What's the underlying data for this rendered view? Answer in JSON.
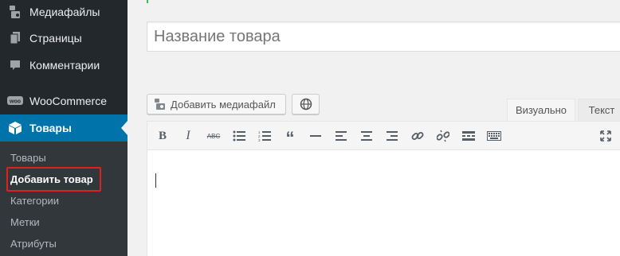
{
  "sidebar": {
    "menu": [
      {
        "label": "Медиафайлы",
        "icon": "media-icon"
      },
      {
        "label": "Страницы",
        "icon": "pages-icon"
      },
      {
        "label": "Комментарии",
        "icon": "comments-icon"
      },
      {
        "label": "WooCommerce",
        "icon": "woocommerce-icon"
      },
      {
        "label": "Товары",
        "icon": "products-icon",
        "active": true
      }
    ],
    "submenu": [
      {
        "label": "Товары"
      },
      {
        "label": "Добавить товар",
        "current": true
      },
      {
        "label": "Категории"
      },
      {
        "label": "Метки"
      },
      {
        "label": "Атрибуты"
      }
    ]
  },
  "editor": {
    "title_placeholder": "Название товара",
    "add_media_label": "Добавить медиафайл",
    "tabs": {
      "visual": "Визуально",
      "text": "Текст"
    },
    "toolbar": {
      "bold": "B",
      "italic": "I",
      "strikethrough": "ABC",
      "blockquote": "“"
    }
  },
  "colors": {
    "sidebar_bg": "#23282d",
    "submenu_bg": "#32373c",
    "active_bg": "#0073aa",
    "highlight_border": "#e02020"
  }
}
